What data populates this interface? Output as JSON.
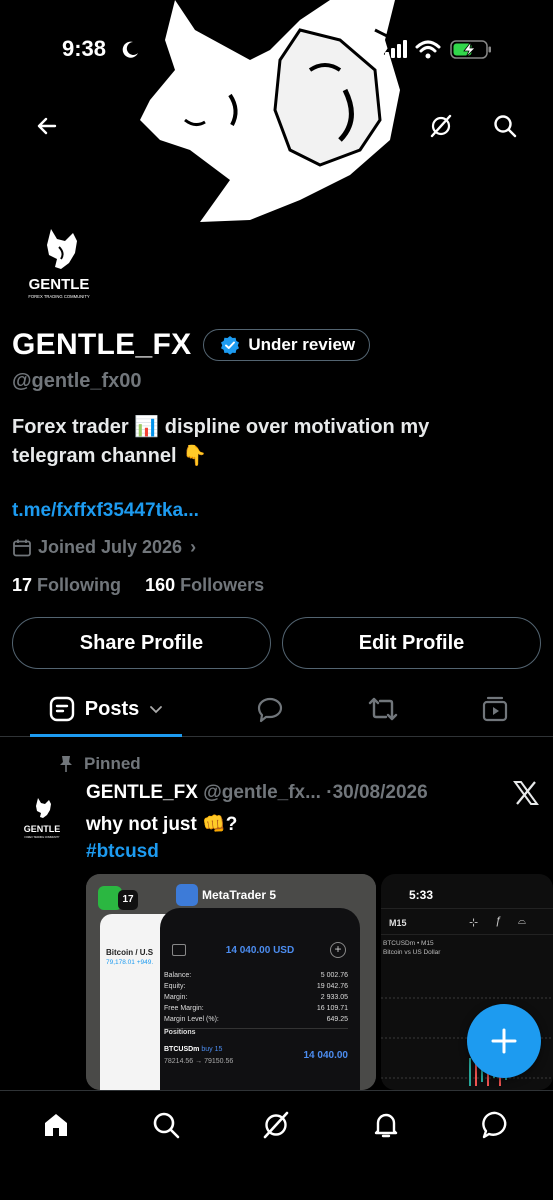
{
  "status_bar": {
    "time": "9:38"
  },
  "profile": {
    "display_name": "GENTLE_FX",
    "badge_label": "Under review",
    "handle": "@gentle_fx00",
    "bio_line1": "Forex trader 📊 displine over motivation my",
    "bio_line2": "telegram channel 👇",
    "link": "t.me/fxffxf35447tka...",
    "joined": "Joined July 2026",
    "following_count": "17",
    "following_label": "Following",
    "followers_count": "160",
    "followers_label": "Followers"
  },
  "avatar": {
    "logo_text": "GENTLE",
    "logo_subtext": "FOREX TRADING COMMUNITY"
  },
  "buttons": {
    "share": "Share Profile",
    "edit": "Edit Profile"
  },
  "tabs": {
    "posts": "Posts"
  },
  "post": {
    "pinned_label": "Pinned",
    "author_name": "GENTLE_FX",
    "author_handle": "@gentle_fx...",
    "date": "·30/08/2026",
    "text": "why not just 👊?",
    "hashtag": "#btcusd"
  },
  "media_left": {
    "app_title": "MetaTrader 5",
    "balance_header": "14 040.00 USD",
    "ticker": "Bitcoin / U.S",
    "ticker_price": "79,178.01 +949.",
    "rows": [
      {
        "label": "Balance:",
        "value": "5 002.76"
      },
      {
        "label": "Equity:",
        "value": "19 042.76"
      },
      {
        "label": "Margin:",
        "value": "2 933.05"
      },
      {
        "label": "Free Margin:",
        "value": "16 109.71"
      },
      {
        "label": "Margin Level (%):",
        "value": "649.25"
      }
    ],
    "positions_label": "Positions",
    "position_symbol": "BTCUSDm",
    "position_side": "buy 15",
    "position_prices": "78214.56 → 79150.56",
    "position_profit": "14 040.00"
  },
  "media_right": {
    "time": "5:33",
    "timeframe": "M15",
    "symbol_line": "BTCUSDm • M15",
    "desc_line": "Bitcoin vs US Dollar"
  },
  "colors": {
    "accent": "#1d9bf0",
    "muted": "#71767b",
    "border": "#536471",
    "battery": "#32d74b"
  }
}
